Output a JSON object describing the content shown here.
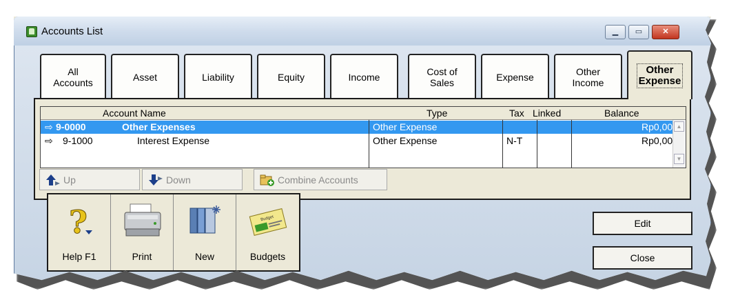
{
  "window": {
    "title": "Accounts List",
    "minimize_glyph": "▁",
    "maximize_glyph": "▭",
    "close_glyph": "✕"
  },
  "tabs": [
    {
      "line1": "All",
      "line2": "Accounts"
    },
    {
      "line1": "Asset",
      "line2": ""
    },
    {
      "line1": "Liability",
      "line2": ""
    },
    {
      "line1": "Equity",
      "line2": ""
    },
    {
      "line1": "Income",
      "line2": ""
    },
    {
      "line1": "Cost of",
      "line2": "Sales"
    },
    {
      "line1": "Expense",
      "line2": ""
    },
    {
      "line1": "Other",
      "line2": "Income"
    },
    {
      "line1": "Other",
      "line2": "Expense"
    }
  ],
  "active_tab": "Other Expense",
  "table": {
    "headers": {
      "name": "Account Name",
      "type": "Type",
      "tax": "Tax",
      "linked": "Linked",
      "balance": "Balance"
    },
    "rows": [
      {
        "arrow": "⇨",
        "number": "9-0000",
        "name": "Other Expenses",
        "type": "Other Expense",
        "tax": "",
        "linked": "",
        "balance": "Rp0,00"
      },
      {
        "arrow": "⇨",
        "number": "9-1000",
        "name": "Interest Expense",
        "type": "Other Expense",
        "tax": "N-T",
        "linked": "",
        "balance": "Rp0,00"
      }
    ]
  },
  "actions": {
    "up": "Up",
    "down": "Down",
    "combine": "Combine Accounts"
  },
  "toolbar": {
    "help": "Help F1",
    "print": "Print",
    "new": "New",
    "budgets": "Budgets",
    "budget_card_text": "Budget"
  },
  "commands": {
    "edit": "Edit",
    "close": "Close"
  },
  "colors": {
    "selection": "#3398f0",
    "disabled_text": "#8a8a8a"
  }
}
